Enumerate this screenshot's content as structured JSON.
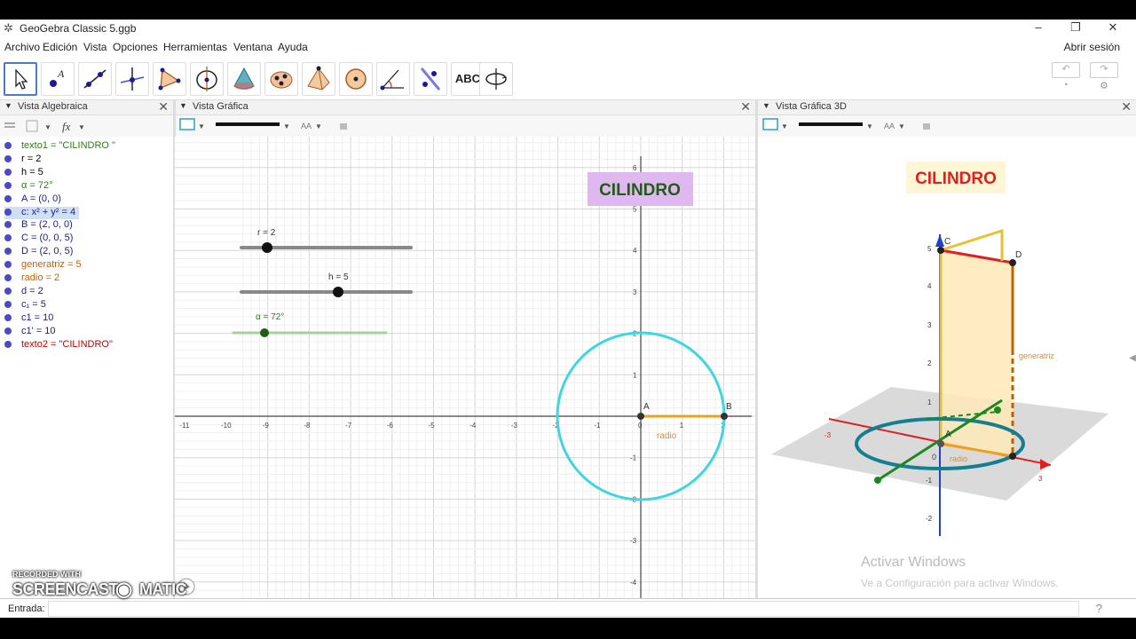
{
  "window": {
    "title": "GeoGebra Classic 5.ggb",
    "minimize": "–",
    "maximize": "❐",
    "close": "✕"
  },
  "menu": {
    "items": [
      "Archivo",
      "Edición",
      "Vista",
      "Opciones",
      "Herramientas",
      "Ventana",
      "Ayuda"
    ],
    "login": "Abrir sesión"
  },
  "toolbar": {
    "text_tool": "ABC"
  },
  "panels": {
    "algebra": "Vista Algebraica",
    "graphics": "Vista Gráfica",
    "graphics3d": "Vista Gráfica 3D"
  },
  "algebra": {
    "items": [
      {
        "text": "texto1 = \"CILINDRO \"",
        "color": "#2e7d12"
      },
      {
        "text": "r = 2",
        "color": "#000000"
      },
      {
        "text": "h = 5",
        "color": "#000000"
      },
      {
        "text": "α = 72°",
        "color": "#2e7d12"
      },
      {
        "text": "A = (0, 0)",
        "color": "#1a1a9a"
      },
      {
        "text": "c: x² + y² = 4",
        "color": "#1a1a9a"
      },
      {
        "text": "B = (2, 0, 0)",
        "color": "#1a1a9a"
      },
      {
        "text": "C = (0, 0, 5)",
        "color": "#1a1a9a"
      },
      {
        "text": "D = (2, 0, 5)",
        "color": "#1a1a9a"
      },
      {
        "text": "generatriz = 5",
        "color": "#c06000"
      },
      {
        "text": "radio = 2",
        "color": "#c06000"
      },
      {
        "text": "d = 2",
        "color": "#1a1a9a"
      },
      {
        "text": "c₁ = 5",
        "color": "#1a1a9a"
      },
      {
        "text": "c1 = 10",
        "color": "#1a1a9a"
      },
      {
        "text": "c1' = 10",
        "color": "#1a1a9a"
      },
      {
        "text": "texto2 = \"CILINDRO\"",
        "color": "#c00000"
      }
    ]
  },
  "graphics2d": {
    "title_text": "CILINDRO",
    "slider_r": "r = 2",
    "slider_h": "h = 5",
    "slider_alpha": "α = 72°",
    "point_A": "A",
    "point_B": "B",
    "segment_label": "radio",
    "x_ticks": [
      "-11",
      "-10",
      "-9",
      "-8",
      "-7",
      "-6",
      "-5",
      "-4",
      "-3",
      "-2",
      "-1",
      "0",
      "1",
      "2"
    ],
    "y_ticks": [
      "6",
      "5",
      "4",
      "3",
      "2",
      "1",
      "-1",
      "-2",
      "-3",
      "-4"
    ]
  },
  "graphics3d": {
    "title_text": "CILINDRO",
    "point_C": "C",
    "point_D": "D",
    "generatriz_label": "generatriz",
    "radio_label": "radio",
    "point_A": "A",
    "z_ticks": [
      "5",
      "4",
      "3",
      "2",
      "1",
      "-1",
      "-2"
    ],
    "x_ticks": [
      "-3",
      "3"
    ],
    "origin": "0"
  },
  "input": {
    "label": "Entrada:",
    "help": "?"
  },
  "watermark": {
    "line1": "Activar Windows",
    "line2": "Ve a Configuración para activar Windows.",
    "rec1": "RECORDED WITH",
    "rec2": "SCREENCAST",
    "rec3": "MATIC"
  },
  "colors": {
    "circle": "#3fd6e0",
    "slider": "#2e7d12",
    "segment": "#f0a020",
    "cyl_teal": "#137f8f",
    "plane_yellow": "#ffe9b8",
    "edge_yellow": "#e8c030",
    "axis_red": "#e02020",
    "axis_blue": "#2040d0"
  }
}
